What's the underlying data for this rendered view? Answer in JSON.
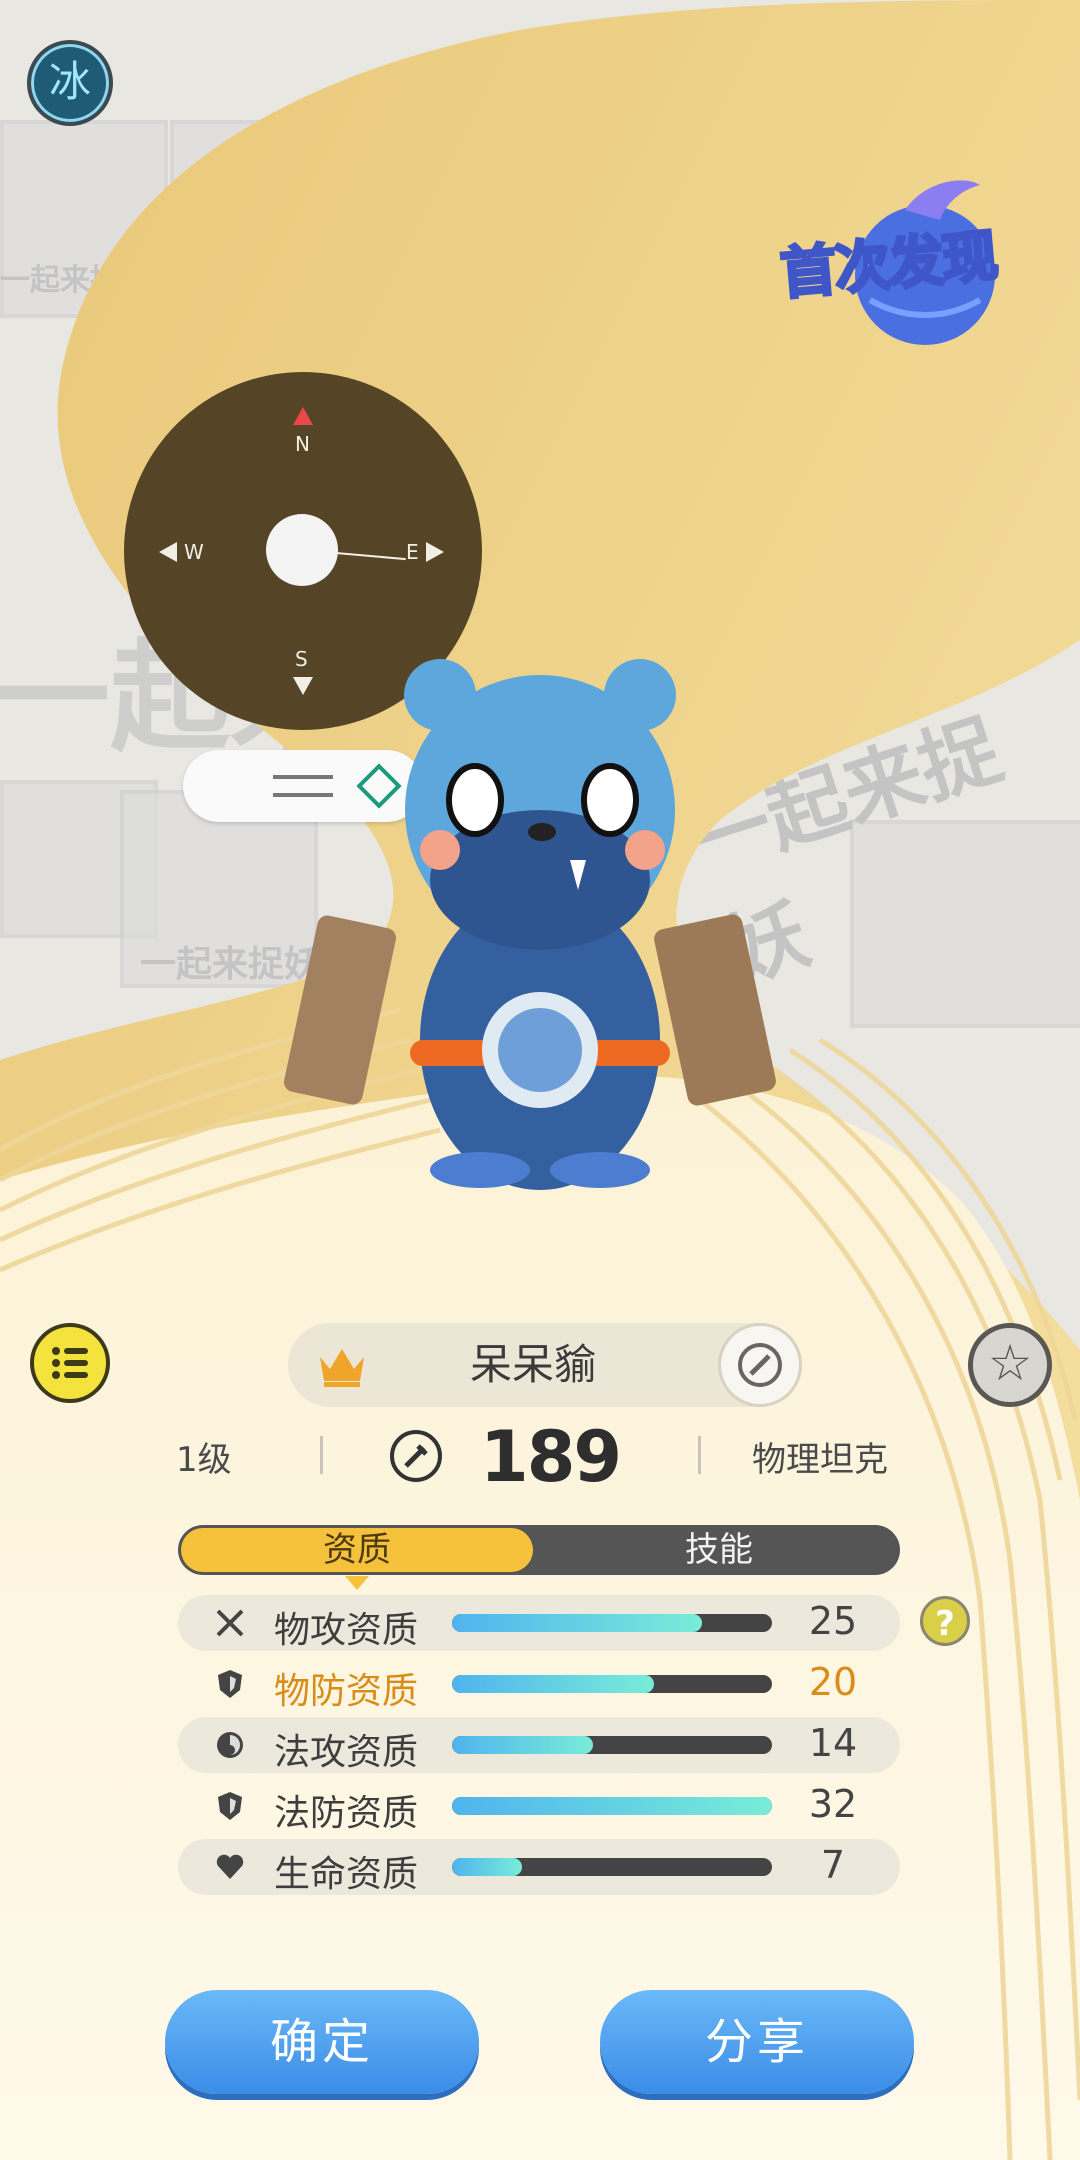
{
  "element_badge": "冰",
  "discover_badge": "首次发现",
  "background_text": [
    "一起来捉妖",
    "一起来捉妖",
    "一起来捉妖",
    "一起来捉妖"
  ],
  "compass": {
    "north": "N",
    "south": "S",
    "east": "E",
    "west": "W"
  },
  "pet": {
    "name": "呆呆貐",
    "level": "1级",
    "combat_power": "189",
    "role": "物理坦克"
  },
  "tabs": [
    "资质",
    "技能"
  ],
  "stats": [
    {
      "label": "物攻资质",
      "value": "25",
      "fill": 0.78,
      "icon": "crossed-swords-icon"
    },
    {
      "label": "物防资质",
      "value": "20",
      "fill": 0.63,
      "icon": "shield-icon",
      "highlight": true
    },
    {
      "label": "法攻资质",
      "value": "14",
      "fill": 0.44,
      "icon": "orb-icon"
    },
    {
      "label": "法防资质",
      "value": "32",
      "fill": 1.0,
      "icon": "shield-icon"
    },
    {
      "label": "生命资质",
      "value": "7",
      "fill": 0.22,
      "icon": "heart-icon"
    }
  ],
  "buttons": {
    "confirm": "确定",
    "share": "分享"
  },
  "colors": {
    "accent": "#f6c13b",
    "highlight": "#d98c18",
    "button": "#4a9ef0"
  }
}
